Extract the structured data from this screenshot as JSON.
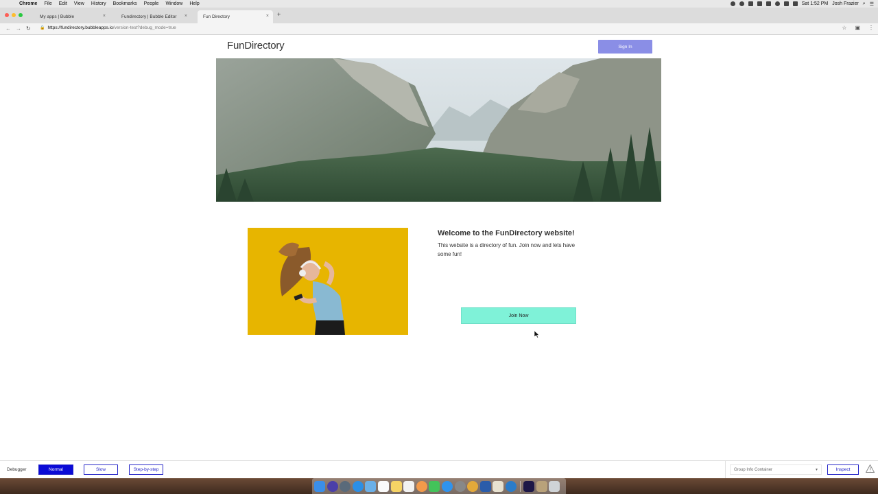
{
  "menubar": {
    "app": "Chrome",
    "items": [
      "File",
      "Edit",
      "View",
      "History",
      "Bookmarks",
      "People",
      "Window",
      "Help"
    ],
    "clock": "Sat 1:52 PM",
    "user": "Josh Frazier"
  },
  "tabs": [
    {
      "label": "My apps | Bubble"
    },
    {
      "label": "Fundirectory | Bubble Editor"
    },
    {
      "label": "Fun Directory"
    }
  ],
  "address": {
    "host": "https://fundirectory.bubbleapps.io",
    "path": "/version-test?debug_mode=true"
  },
  "page": {
    "brand": "FunDirectory",
    "signin_label": "Sign In",
    "welcome_title": "Welcome to the FunDirectory website!",
    "welcome_body": "This website is a directory of fun.  Join now and lets have some fun!",
    "join_label": "Join Now"
  },
  "debugger": {
    "label": "Debugger",
    "modes": [
      "Normal",
      "Slow",
      "Step-by-step"
    ],
    "selected_mode": "Normal",
    "element_select": "Group Info Container",
    "inspect_label": "Inspect"
  },
  "colors": {
    "signin": "#8a8ee6",
    "join": "#7ff2d8",
    "debug_active": "#0b0bd6"
  }
}
